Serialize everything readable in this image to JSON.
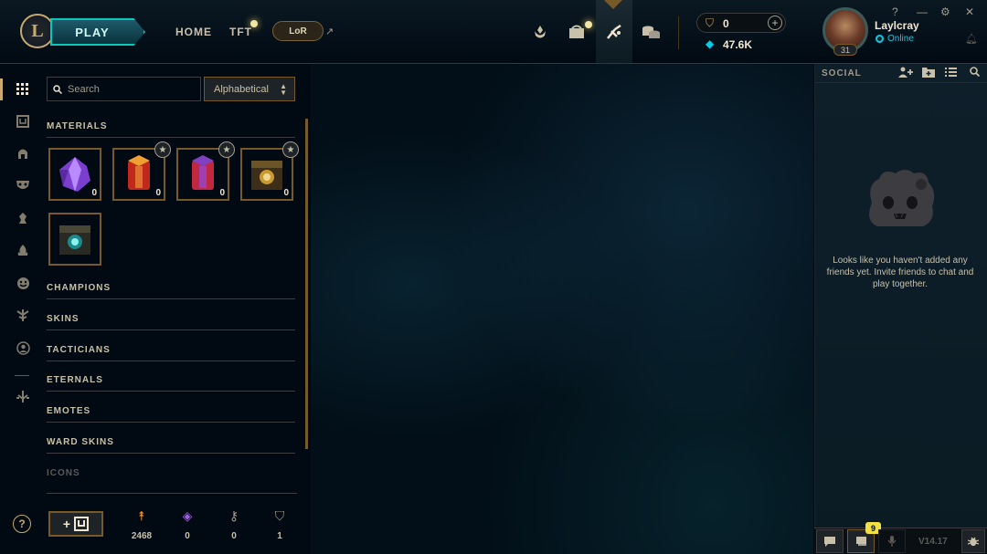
{
  "topbar": {
    "logo": "L",
    "play_label": "PLAY",
    "home_label": "HOME",
    "tft_label": "TFT",
    "lor_label": "LoR",
    "rp_value": "0",
    "be_value": "47.6K"
  },
  "profile": {
    "username": "Laylcray",
    "status": "Online",
    "level": "31"
  },
  "window_controls": {
    "help": "?",
    "minimize": "—",
    "settings": "⚙",
    "close": "✕"
  },
  "loot": {
    "search_placeholder": "Search",
    "sort_value": "Alphabetical",
    "sections": {
      "materials": "MATERIALS",
      "champions": "CHAMPIONS",
      "skins": "SKINS",
      "tacticians": "TACTICIANS",
      "eternals": "ETERNALS",
      "emotes": "EMOTES",
      "ward_skins": "WARD SKINS",
      "icons": "ICONS"
    },
    "material_items": [
      {
        "name": "crystal",
        "count": "0"
      },
      {
        "name": "red-capsule",
        "count": "0"
      },
      {
        "name": "purple-capsule",
        "count": "0"
      },
      {
        "name": "gold-chest",
        "count": "0"
      },
      {
        "name": "hextech-chest",
        "count": ""
      }
    ],
    "disenchant_label": "+",
    "bottom_currencies": [
      {
        "icon": "orange-essence-icon",
        "value": "2468"
      },
      {
        "icon": "mythic-essence-icon",
        "value": "0"
      },
      {
        "icon": "key-icon",
        "value": "0"
      },
      {
        "icon": "chest-icon",
        "value": "1"
      }
    ]
  },
  "social": {
    "title": "SOCIAL",
    "empty_message": "Looks like you haven't added any friends yet. Invite friends to chat and play together.",
    "chat_badge": "9",
    "version": "V14.17"
  },
  "colors": {
    "gold": "#c8aa6e",
    "teal": "#0ac8b9",
    "online": "#0acbe6",
    "background": "#010a13"
  }
}
